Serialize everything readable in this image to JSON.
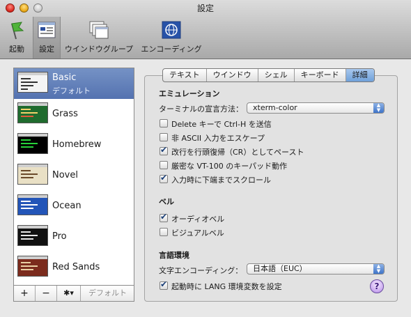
{
  "window": {
    "title": "設定"
  },
  "toolbar": {
    "items": [
      {
        "label": "起動",
        "icon": "launch-flag-icon"
      },
      {
        "label": "設定",
        "icon": "settings-window-icon"
      },
      {
        "label": "ウインドウグループ",
        "icon": "window-groups-icon"
      },
      {
        "label": "エンコーディング",
        "icon": "encoding-globe-icon"
      }
    ]
  },
  "profiles": [
    {
      "name": "Basic",
      "default_label": "デフォルト",
      "thumb_bg": "#f4f4f4",
      "thumb_fg": "#333333"
    },
    {
      "name": "Grass",
      "thumb_bg": "#1f6b2e",
      "thumb_fg": "#f3d16b"
    },
    {
      "name": "Homebrew",
      "thumb_bg": "#000000",
      "thumb_fg": "#27d33a"
    },
    {
      "name": "Novel",
      "thumb_bg": "#e9e0c5",
      "thumb_fg": "#6b4a2a"
    },
    {
      "name": "Ocean",
      "thumb_bg": "#2355b8",
      "thumb_fg": "#ffffff"
    },
    {
      "name": "Pro",
      "thumb_bg": "#111111",
      "thumb_fg": "#e6e6e6"
    },
    {
      "name": "Red Sands",
      "thumb_bg": "#7b2b1d",
      "thumb_fg": "#e9cfa3"
    }
  ],
  "sidebar_bottom": {
    "add": "+",
    "remove": "−",
    "gear": "✱▾",
    "default": "デフォルト"
  },
  "tabs": [
    {
      "label": "テキスト"
    },
    {
      "label": "ウインドウ"
    },
    {
      "label": "シェル"
    },
    {
      "label": "キーボード"
    },
    {
      "label": "詳細",
      "active": true
    }
  ],
  "emulation": {
    "heading": "エミュレーション",
    "terminal_label": "ターミナルの宣言方法：",
    "terminal_value": "xterm-color",
    "checkboxes": [
      {
        "label": "Delete キーで Ctrl-H を送信",
        "checked": false
      },
      {
        "label": "非 ASCII 入力をエスケープ",
        "checked": false
      },
      {
        "label": "改行を行頭復帰（CR）としてペースト",
        "checked": true
      },
      {
        "label": "厳密な VT-100 のキーパッド動作",
        "checked": false
      },
      {
        "label": "入力時に下端までスクロール",
        "checked": true
      }
    ]
  },
  "bell": {
    "heading": "ベル",
    "checkboxes": [
      {
        "label": "オーディオベル",
        "checked": true
      },
      {
        "label": "ビジュアルベル",
        "checked": false
      }
    ]
  },
  "language": {
    "heading": "言語環境",
    "encoding_label": "文字エンコーディング：",
    "encoding_value": "日本語（EUC）",
    "checkbox": {
      "label": "起動時に LANG 環境変数を設定",
      "checked": true
    }
  },
  "help": "?"
}
